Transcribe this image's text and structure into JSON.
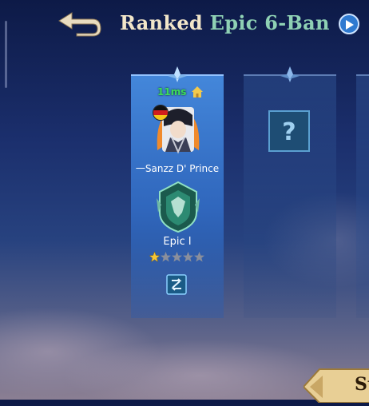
{
  "header": {
    "title_part1": "Ranked",
    "title_part2": "Epic 6-Ban"
  },
  "icons": {
    "back": "back-arrow-icon",
    "play": "play-icon",
    "home": "home-icon",
    "switch": "switch-icon",
    "unknown": "question-mark-icon"
  },
  "slots": [
    {
      "status": "filled",
      "ping": "11ms",
      "country_flag": "germany",
      "player_name": "一Sanzz D' Prince",
      "rank": "Epic I",
      "stars_filled": 1,
      "stars_total": 5
    },
    {
      "status": "empty",
      "placeholder": "?"
    }
  ],
  "footer": {
    "start_label": "St"
  },
  "colors": {
    "title_primary": "#f2e6c9",
    "title_accent": "#8fd1b4",
    "ping_green": "#3ddc5a",
    "slot_active": "#4a8ce1",
    "star_gold": "#f6c635",
    "star_empty": "#8a8f9c"
  }
}
